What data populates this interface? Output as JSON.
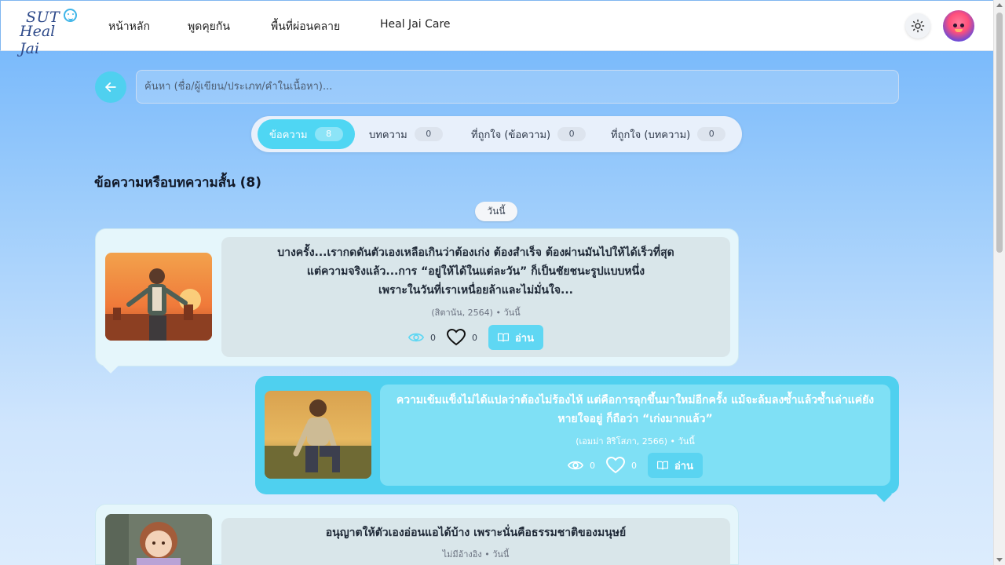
{
  "header": {
    "logo_line1": "SUT",
    "logo_line2": "Heal Jai",
    "nav": [
      "หน้าหลัก",
      "พูดคุยกัน",
      "พื้นที่ผ่อนคลาย",
      "Heal Jai Care"
    ]
  },
  "search": {
    "placeholder": "ค้นหา (ชื่อ/ผู้เขียน/ประเภท/คำในเนื้อหา)..."
  },
  "tabs": [
    {
      "label": "ข้อความ",
      "count": "8",
      "active": true
    },
    {
      "label": "บทความ",
      "count": "0",
      "active": false
    },
    {
      "label": "ที่ถูกใจ (ข้อความ)",
      "count": "0",
      "active": false
    },
    {
      "label": "ที่ถูกใจ (บทความ)",
      "count": "0",
      "active": false
    }
  ],
  "section_title": "ข้อความหรือบทความสั้น (8)",
  "date_label": "วันนี้",
  "cards": [
    {
      "lines": [
        "บางครั้ง...เรากดดันตัวเองเหลือเกินว่าต้องเก่ง ต้องสำเร็จ ต้องผ่านมันไปให้ได้เร็วที่สุด",
        "แต่ความจริงแล้ว...การ “อยู่ให้ได้ในแต่ละวัน” ก็เป็นชัยชนะรูปแบบหนึ่ง",
        "เพราะในวันที่เราเหนื่อยล้าและไม่มั่นใจ..."
      ],
      "meta": "(สิตานัน, 2564) • วันนี้",
      "views": "0",
      "likes": "0",
      "read_label": "อ่าน"
    },
    {
      "lines": [
        "ความเข้มแข็งไม่ได้แปลว่าต้องไม่ร้องไห้ แต่คือการลุกขึ้นมาใหม่อีกครั้ง แม้จะล้มลงซ้ำแล้วซ้ำเล่าแค่ยัง",
        "หายใจอยู่ ก็ถือว่า “เก่งมากแล้ว”"
      ],
      "meta": "(เอมม่า สิริโสภา, 2566) • วันนี้",
      "views": "0",
      "likes": "0",
      "read_label": "อ่าน"
    },
    {
      "lines": [
        "อนุญาตให้ตัวเองอ่อนแอได้บ้าง เพราะนั่นคือธรรมชาติของมนุษย์"
      ],
      "meta": "ไม่มีอ้างอิง • วันนี้"
    }
  ],
  "colors": {
    "accent": "#4fd0ef",
    "header_bg": "#ffffff"
  }
}
